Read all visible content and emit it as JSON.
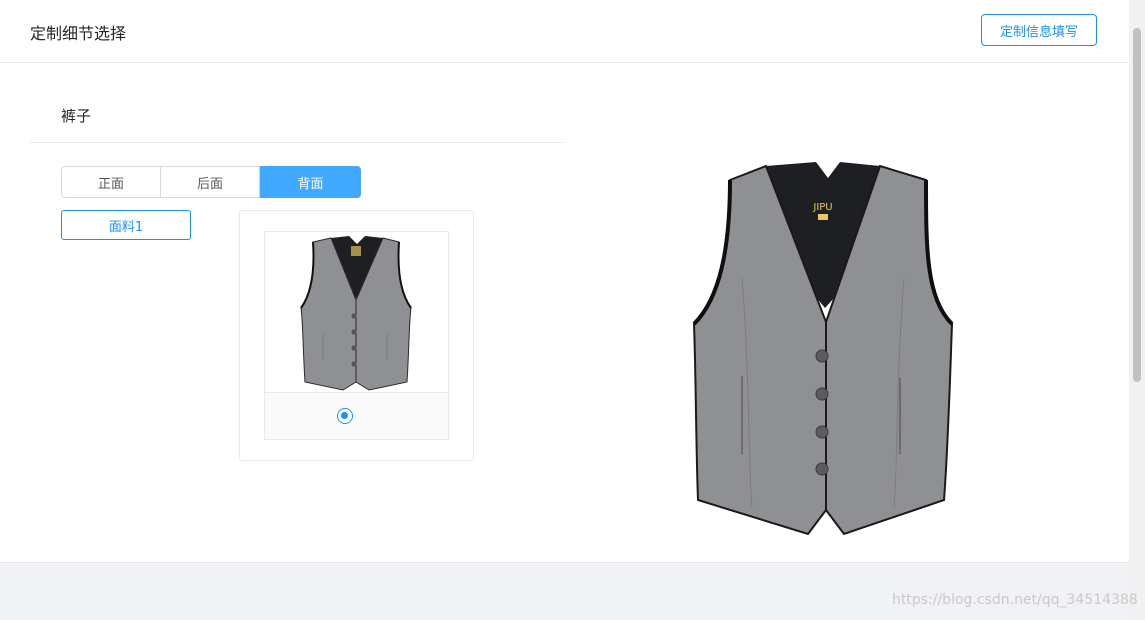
{
  "header": {
    "title": "定制细节选择",
    "fill_button_label": "定制信息填写"
  },
  "section": {
    "title": "裤子"
  },
  "views": [
    {
      "label": "正面",
      "active": false
    },
    {
      "label": "后面",
      "active": false
    },
    {
      "label": "背面",
      "active": true
    }
  ],
  "fabric_button_label": "面料1",
  "option": {
    "selected": true,
    "image": "vest-thumbnail"
  },
  "preview": {
    "image": "vest-large",
    "brand_label": "JIPU"
  },
  "watermark": "https://blog.csdn.net/qq_34514388",
  "colors": {
    "accent": "#1890ff",
    "active_tab": "#40a9ff",
    "vest_gray": "#8f9094",
    "vest_lining": "#1e1f23"
  }
}
